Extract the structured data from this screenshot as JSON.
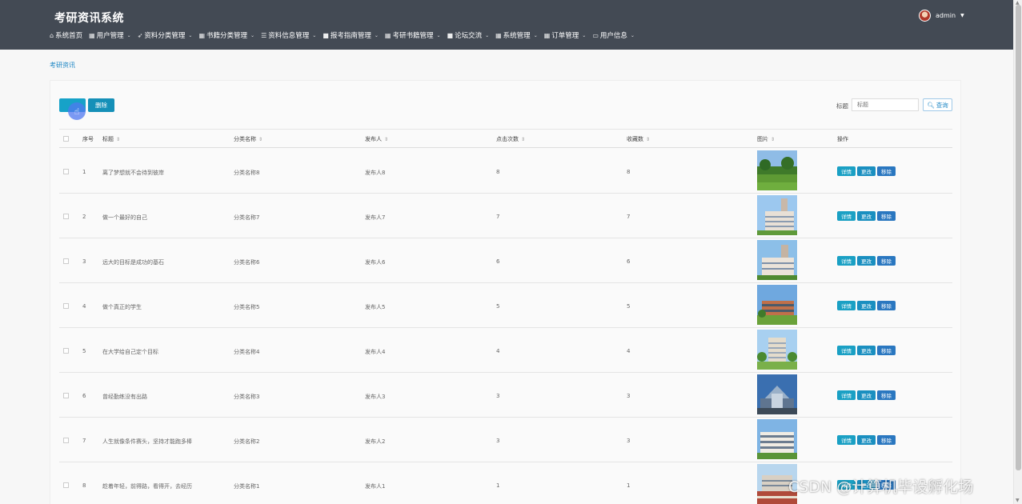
{
  "app": {
    "title": "考研资讯系统"
  },
  "user": {
    "name": "admin"
  },
  "nav": [
    {
      "icon": "home-icon",
      "glyph": "⌂",
      "label": "系统首页",
      "dropdown": false
    },
    {
      "icon": "grid-icon",
      "glyph": "▦",
      "label": "用户管理",
      "dropdown": true
    },
    {
      "icon": "send-icon",
      "glyph": "➶",
      "label": "资料分类管理",
      "dropdown": true
    },
    {
      "icon": "grid-icon",
      "glyph": "▦",
      "label": "书籍分类管理",
      "dropdown": true
    },
    {
      "icon": "list-icon",
      "glyph": "☰",
      "label": "资料信息管理",
      "dropdown": true
    },
    {
      "icon": "book-icon",
      "glyph": "■",
      "label": "报考指南管理",
      "dropdown": true
    },
    {
      "icon": "grid-icon",
      "glyph": "▦",
      "label": "考研书籍管理",
      "dropdown": true
    },
    {
      "icon": "chat-icon",
      "glyph": "■",
      "label": "论坛交流",
      "dropdown": true
    },
    {
      "icon": "grid-icon",
      "glyph": "▦",
      "label": "系统管理",
      "dropdown": true
    },
    {
      "icon": "grid-icon",
      "glyph": "▦",
      "label": "订单管理",
      "dropdown": true
    },
    {
      "icon": "card-icon",
      "glyph": "▭",
      "label": "用户信息",
      "dropdown": true
    }
  ],
  "breadcrumb": "考研资讯",
  "toolbar": {
    "add_label": "",
    "delete_label": "删除"
  },
  "search": {
    "label": "标题",
    "placeholder": "标题",
    "button_label": "查询"
  },
  "table": {
    "headers": {
      "index": "序号",
      "title": "标题",
      "category": "分类名称",
      "publisher": "发布人",
      "clicks": "点击次数",
      "favorites": "收藏数",
      "image": "图片",
      "actions": "操作"
    },
    "actions": {
      "detail": "详情",
      "edit": "更改",
      "remove": "移除"
    },
    "rows": [
      {
        "index": "1",
        "title": "离了梦想就不会待到彼岸",
        "category": "分类名称8",
        "publisher": "发布人8",
        "clicks": "8",
        "favorites": "8"
      },
      {
        "index": "2",
        "title": "做一个最好的自己",
        "category": "分类名称7",
        "publisher": "发布人7",
        "clicks": "7",
        "favorites": "7"
      },
      {
        "index": "3",
        "title": "远大的目标是成功的基石",
        "category": "分类名称6",
        "publisher": "发布人6",
        "clicks": "6",
        "favorites": "6"
      },
      {
        "index": "4",
        "title": "做个真正的学生",
        "category": "分类名称5",
        "publisher": "发布人5",
        "clicks": "5",
        "favorites": "5"
      },
      {
        "index": "5",
        "title": "在大学给自己定个目标",
        "category": "分类名称4",
        "publisher": "发布人4",
        "clicks": "4",
        "favorites": "4"
      },
      {
        "index": "6",
        "title": "曾经勤练没有出路",
        "category": "分类名称3",
        "publisher": "发布人3",
        "clicks": "3",
        "favorites": "3"
      },
      {
        "index": "7",
        "title": "人生就像条件赛头，坚持才能跑多棒",
        "category": "分类名称2",
        "publisher": "发布人2",
        "clicks": "3",
        "favorites": "3"
      },
      {
        "index": "8",
        "title": "趁着年轻，前得路，看得开，去经历",
        "category": "分类名称1",
        "publisher": "发布人1",
        "clicks": "1",
        "favorites": "1"
      }
    ]
  },
  "watermark": "CSDN @计算机毕设孵化场",
  "colors": {
    "header_bg": "#434a54",
    "primary": "#17a2c8",
    "link": "#1e87c5"
  }
}
